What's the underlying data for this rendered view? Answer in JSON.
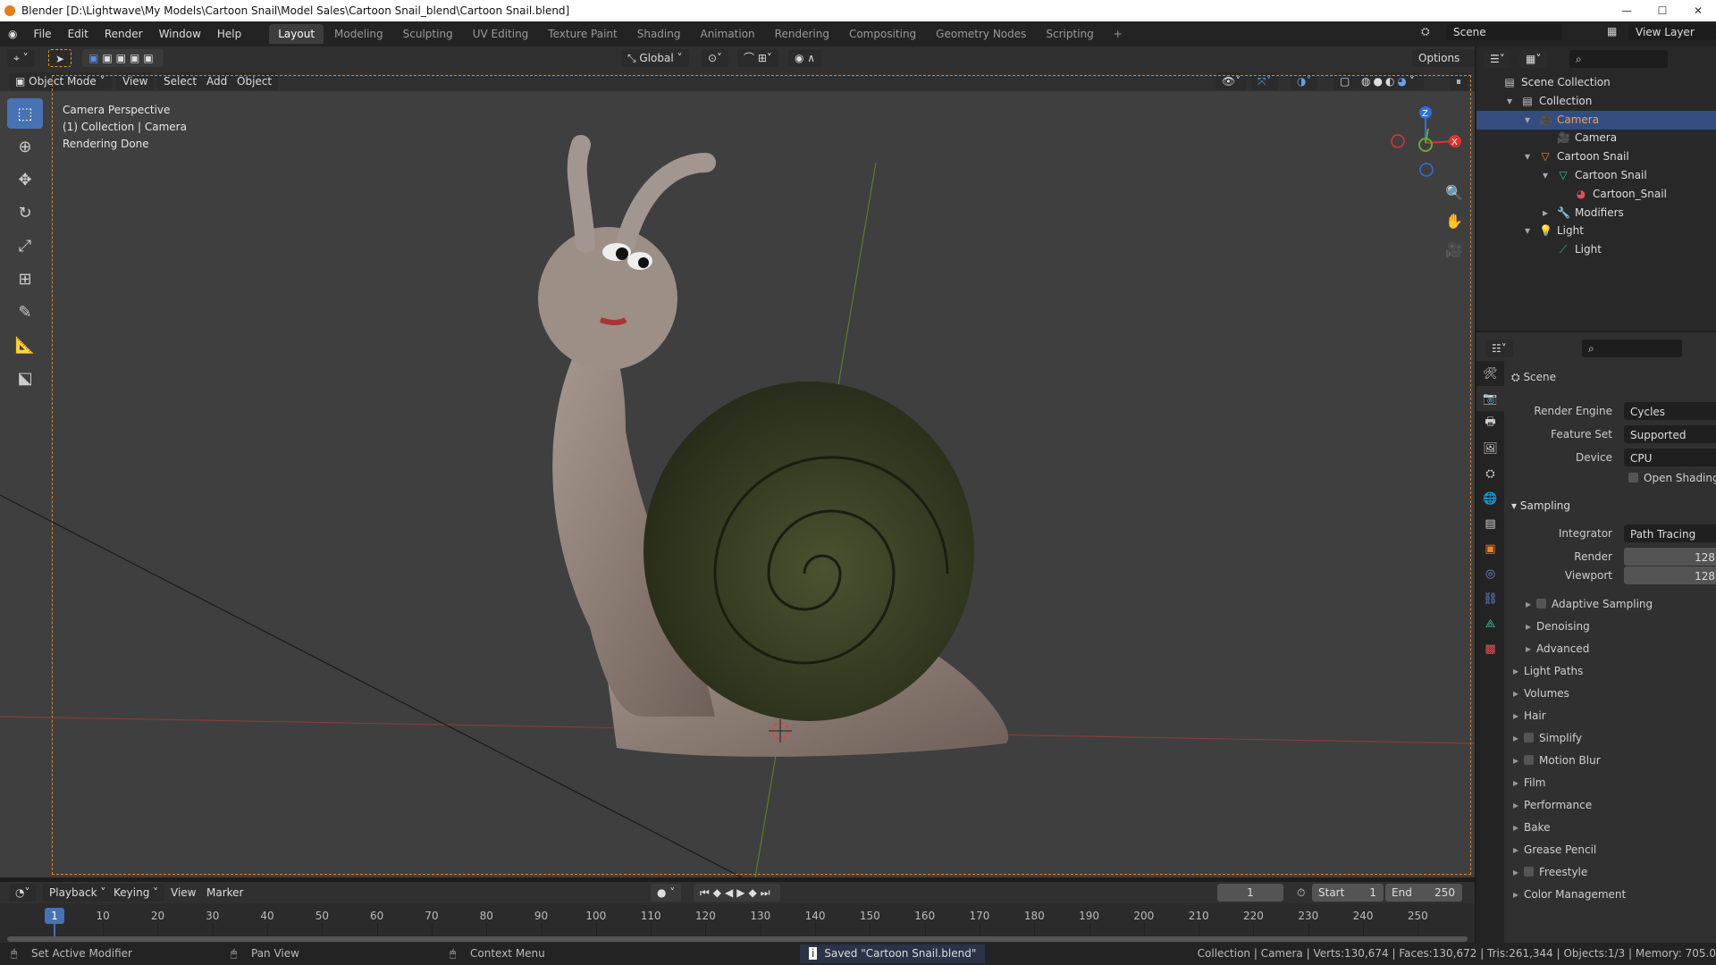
{
  "title": "Blender [D:\\Lightwave\\My Models\\Cartoon Snail\\Model Sales\\Cartoon Snail_blend\\Cartoon Snail.blend]",
  "menus": [
    "File",
    "Edit",
    "Render",
    "Window",
    "Help"
  ],
  "workspaces": [
    "Layout",
    "Modeling",
    "Sculpting",
    "UV Editing",
    "Texture Paint",
    "Shading",
    "Animation",
    "Rendering",
    "Compositing",
    "Geometry Nodes",
    "Scripting",
    "+"
  ],
  "scene_field": "Scene",
  "view_layer_field": "View Layer",
  "header": {
    "orientation": "Global",
    "options": "Options"
  },
  "viewport_header": {
    "mode": "Object Mode",
    "menus": [
      "View",
      "Select",
      "Add",
      "Object"
    ]
  },
  "overlay": {
    "line1": "Camera Perspective",
    "line2": "(1) Collection | Camera",
    "line3": "Rendering Done"
  },
  "gizmo": {
    "z": "Z",
    "y": "Y",
    "x": "X"
  },
  "outliner": [
    {
      "label": "Scene Collection",
      "icon": "▤",
      "indent": 0,
      "arrow": ""
    },
    {
      "label": "Collection",
      "icon": "▤",
      "indent": 1,
      "arrow": "▾"
    },
    {
      "label": "Camera",
      "icon": "🎥",
      "indent": 2,
      "arrow": "▾",
      "selected": true,
      "color": "#e8a050"
    },
    {
      "label": "Camera",
      "icon": "🎥",
      "indent": 3,
      "arrow": "",
      "color": "#2fbf9a"
    },
    {
      "label": "Cartoon Snail",
      "icon": "▽",
      "indent": 2,
      "arrow": "▾",
      "color": "#e8872a"
    },
    {
      "label": "Cartoon Snail",
      "icon": "▽",
      "indent": 3,
      "arrow": "▾",
      "color": "#2fbf9a"
    },
    {
      "label": "Cartoon_Snail",
      "icon": "◕",
      "indent": 4,
      "arrow": "",
      "color": "#e05060"
    },
    {
      "label": "Modifiers",
      "icon": "🔧",
      "indent": 3,
      "arrow": "▸",
      "color": "#6a8fd8"
    },
    {
      "label": "Light",
      "icon": "💡",
      "indent": 2,
      "arrow": "▾",
      "color": "#e8872a"
    },
    {
      "label": "Light",
      "icon": "⟋",
      "indent": 3,
      "arrow": "",
      "color": "#2fbf9a"
    }
  ],
  "properties": {
    "context": "Scene",
    "render_engine_label": "Render Engine",
    "render_engine": "Cycles",
    "feature_set_label": "Feature Set",
    "feature_set": "Supported",
    "device_label": "Device",
    "device": "CPU",
    "open_shading": "Open Shading La",
    "sampling": "Sampling",
    "integrator_label": "Integrator",
    "integrator": "Path Tracing",
    "render_label": "Render",
    "render_samples": "128",
    "viewport_label": "Viewport",
    "viewport_samples": "128",
    "subsections": [
      {
        "label": "Adaptive Sampling",
        "check": true
      },
      {
        "label": "Denoising",
        "check": false
      },
      {
        "label": "Advanced",
        "check": false
      }
    ],
    "sections": [
      {
        "label": "Light Paths",
        "check": false
      },
      {
        "label": "Volumes",
        "check": false
      },
      {
        "label": "Hair",
        "check": false
      },
      {
        "label": "Simplify",
        "check": true
      },
      {
        "label": "Motion Blur",
        "check": true
      },
      {
        "label": "Film",
        "check": false
      },
      {
        "label": "Performance",
        "check": false
      },
      {
        "label": "Bake",
        "check": false
      },
      {
        "label": "Grease Pencil",
        "check": false
      },
      {
        "label": "Freestyle",
        "check": true
      },
      {
        "label": "Color Management",
        "check": false
      }
    ]
  },
  "timeline": {
    "menus": [
      "Playback",
      "Keying",
      "View",
      "Marker"
    ],
    "current_frame": "1",
    "start_label": "Start",
    "start": "1",
    "end_label": "End",
    "end": "250",
    "ticks": [
      10,
      20,
      30,
      40,
      50,
      60,
      70,
      80,
      90,
      100,
      110,
      120,
      130,
      140,
      150,
      160,
      170,
      180,
      190,
      200,
      210,
      220,
      230,
      240,
      250
    ]
  },
  "status": {
    "left1": "Set Active Modifier",
    "left2": "Pan View",
    "left3": "Context Menu",
    "message": "Saved \"Cartoon Snail.blend\"",
    "stats": "Collection | Camera | Verts:130,674 | Faces:130,672 | Tris:261,344 | Objects:1/3 | Memory: 705.0"
  }
}
